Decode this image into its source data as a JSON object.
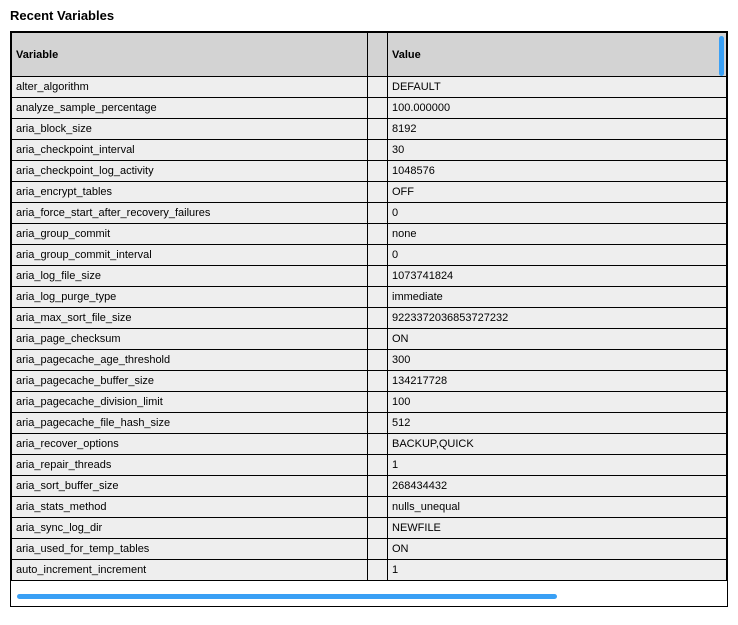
{
  "title": "Recent Variables",
  "columns": {
    "variable": "Variable",
    "value": "Value"
  },
  "rows": [
    {
      "variable": "alter_algorithm",
      "value": "DEFAULT"
    },
    {
      "variable": "analyze_sample_percentage",
      "value": "100.000000"
    },
    {
      "variable": "aria_block_size",
      "value": "8192"
    },
    {
      "variable": "aria_checkpoint_interval",
      "value": "30"
    },
    {
      "variable": "aria_checkpoint_log_activity",
      "value": "1048576"
    },
    {
      "variable": "aria_encrypt_tables",
      "value": "OFF"
    },
    {
      "variable": "aria_force_start_after_recovery_failures",
      "value": "0"
    },
    {
      "variable": "aria_group_commit",
      "value": "none"
    },
    {
      "variable": "aria_group_commit_interval",
      "value": "0"
    },
    {
      "variable": "aria_log_file_size",
      "value": "1073741824"
    },
    {
      "variable": "aria_log_purge_type",
      "value": "immediate"
    },
    {
      "variable": "aria_max_sort_file_size",
      "value": "9223372036853727232"
    },
    {
      "variable": "aria_page_checksum",
      "value": "ON"
    },
    {
      "variable": "aria_pagecache_age_threshold",
      "value": "300"
    },
    {
      "variable": "aria_pagecache_buffer_size",
      "value": "134217728"
    },
    {
      "variable": "aria_pagecache_division_limit",
      "value": "100"
    },
    {
      "variable": "aria_pagecache_file_hash_size",
      "value": "512"
    },
    {
      "variable": "aria_recover_options",
      "value": "BACKUP,QUICK"
    },
    {
      "variable": "aria_repair_threads",
      "value": "1"
    },
    {
      "variable": "aria_sort_buffer_size",
      "value": "268434432"
    },
    {
      "variable": "aria_stats_method",
      "value": "nulls_unequal"
    },
    {
      "variable": "aria_sync_log_dir",
      "value": "NEWFILE"
    },
    {
      "variable": "aria_used_for_temp_tables",
      "value": "ON"
    },
    {
      "variable": "auto_increment_increment",
      "value": "1"
    }
  ]
}
